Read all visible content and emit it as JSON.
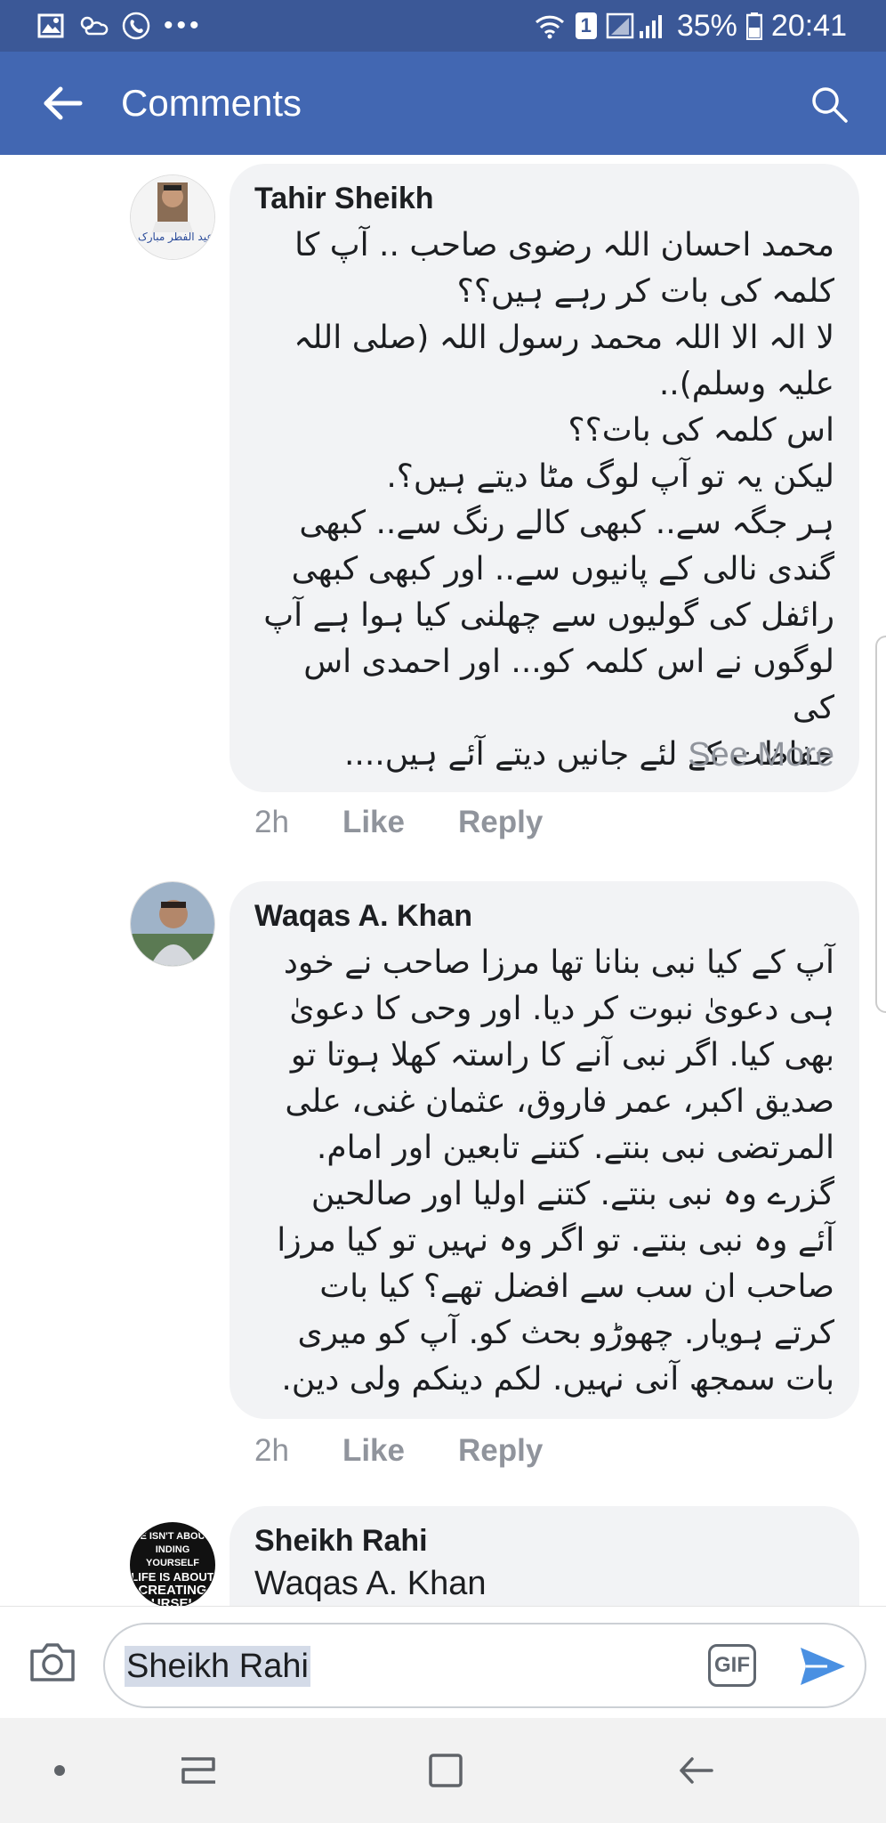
{
  "status_bar": {
    "sim_badge": "1",
    "battery_percent": "35%",
    "time": "20:41",
    "icons": [
      "image-icon",
      "weather-icon",
      "phone-call-icon",
      "more-dots-icon",
      "wifi-icon",
      "signal-icon",
      "battery-icon"
    ]
  },
  "app_bar": {
    "title": "Comments",
    "back_icon": "arrow-left-icon",
    "search_icon": "search-icon"
  },
  "comments": [
    {
      "author": "Tahir Sheikh",
      "avatar_icon": "user-avatar",
      "avatar_caption": "عید الفطر مبارک",
      "text": "محمد احسان اللہ رضوی صاحب .. آپ کا\nکلمہ کی بات کر رہے ہیں؟؟\nلا الہ الا اللہ محمد رسول اللہ (صلی اللہ\nعلیہ وسلم)..\nاس کلمہ کی بات؟؟\nلیکن یہ تو آپ لوگ مٹا دیتے ہیں؟.\nہر جگہ سے.. کبھی کالے رنگ سے.. کبھی\nگندی نالی کے پانیوں سے.. اور کبھی کبھی\nرائفل کی گولیوں سے چھلنی کیا ہوا ہے آپ\nلوگوں نے اس کلمہ کو... اور احمدی اس کی\nحفاظت کے لئے جانیں دیتے آئے ہیں....",
      "see_more": "See More",
      "time": "2h",
      "like": "Like",
      "reply": "Reply"
    },
    {
      "author": "Waqas A. Khan",
      "avatar_icon": "user-avatar",
      "text": "آپ کے کیا نبی بنانا تھا مرزا صاحب نے خود\nہی دعویٰ نبوت کر دیا. اور وحی کا دعویٰ\nبھی کیا. اگر نبی آنے کا راستہ کھلا ہوتا تو\nصدیق اکبر، عمر فاروق، عثمان غنی، علی\nالمرتضی نبی بنتے. کتنے تابعین اور امام.\nگزرے وہ نبی بنتے. کتنے اولیا اور صالحین\nآئے وہ نبی بنتے. تو اگر وہ نہیں تو کیا مرزا\nصاحب ان سب سے افضل تھے؟ کیا بات\nکرتے ہویار. چھوڑو بحث کو. آپ کو میری\nبات سمجھ آنی نہیں. لکم دینکم ولی دین.",
      "time": "2h",
      "like": "Like",
      "reply": "Reply"
    },
    {
      "author": "Sheikh Rahi",
      "avatar_icon": "user-avatar",
      "avatar_caption_lines": [
        "E ISN'T ABOU",
        "INDING YOURSELF",
        "LIFE IS ABOUT",
        "CREATING",
        "OURSELF"
      ],
      "text_first_line": "Waqas A. Khan"
    }
  ],
  "composer": {
    "value": "Sheikh Rahi",
    "camera_icon": "camera-icon",
    "gif_label": "GIF",
    "send_icon": "send-icon"
  },
  "nav_bar": {
    "icons": [
      "dot-icon",
      "recent-apps-icon",
      "home-icon",
      "back-icon"
    ]
  },
  "colors": {
    "status_bar": "#3b5897",
    "app_bar": "#4267b2",
    "bubble": "#f2f3f5",
    "meta_text": "#90949c",
    "send_blue": "#4a90e2"
  }
}
